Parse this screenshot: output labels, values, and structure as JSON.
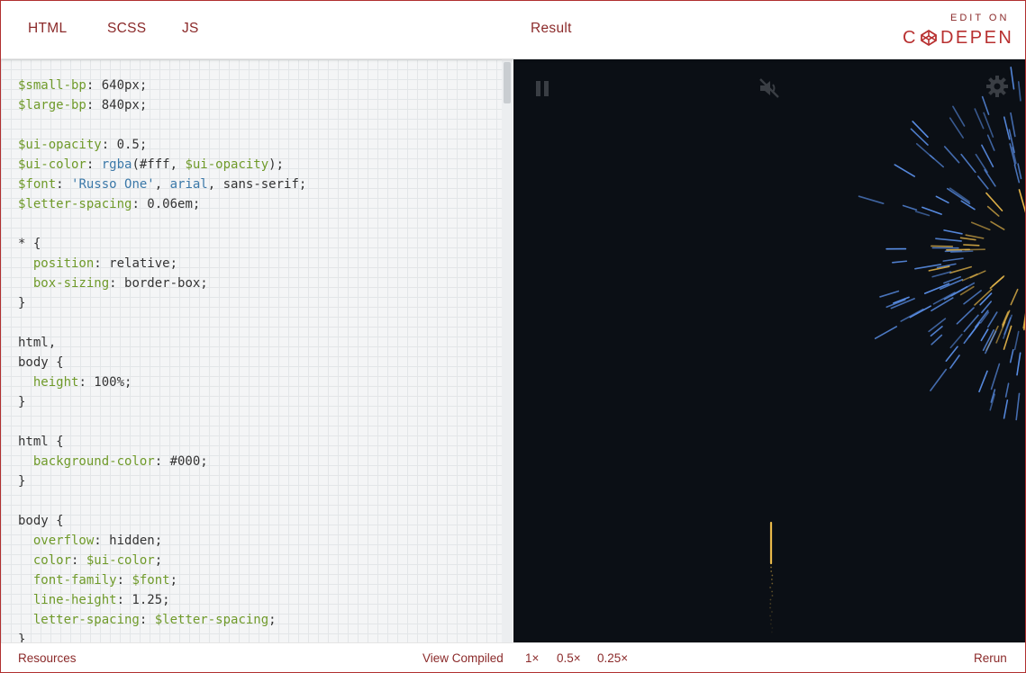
{
  "header": {
    "tabs": [
      "HTML",
      "SCSS",
      "JS"
    ],
    "result_label": "Result",
    "edit_on": "EDIT ON",
    "brand": "CODEPEN",
    "brand_prefix": "C",
    "brand_suffix": "DEPEN"
  },
  "code_lines": [
    [
      [
        "v",
        "$small-bp"
      ],
      [
        "t",
        ": 640px;"
      ]
    ],
    [
      [
        "v",
        "$large-bp"
      ],
      [
        "t",
        ": 840px;"
      ]
    ],
    [],
    [
      [
        "v",
        "$ui-opacity"
      ],
      [
        "t",
        ": 0.5;"
      ]
    ],
    [
      [
        "v",
        "$ui-color"
      ],
      [
        "t",
        ": "
      ],
      [
        "s",
        "rgba"
      ],
      [
        "t",
        "(#fff, "
      ],
      [
        "v",
        "$ui-opacity"
      ],
      [
        "t",
        ");"
      ]
    ],
    [
      [
        "v",
        "$font"
      ],
      [
        "t",
        ": "
      ],
      [
        "s",
        "'Russo One'"
      ],
      [
        "t",
        ", "
      ],
      [
        "s",
        "arial"
      ],
      [
        "t",
        ", sans-serif;"
      ]
    ],
    [
      [
        "v",
        "$letter-spacing"
      ],
      [
        "t",
        ": 0.06em;"
      ]
    ],
    [],
    [
      [
        "t",
        "* {"
      ]
    ],
    [
      [
        "t",
        "  "
      ],
      [
        "p",
        "position"
      ],
      [
        "t",
        ": relative;"
      ]
    ],
    [
      [
        "t",
        "  "
      ],
      [
        "p",
        "box-sizing"
      ],
      [
        "t",
        ": border-box;"
      ]
    ],
    [
      [
        "t",
        "}"
      ]
    ],
    [],
    [
      [
        "t",
        "html,"
      ]
    ],
    [
      [
        "t",
        "body {"
      ]
    ],
    [
      [
        "t",
        "  "
      ],
      [
        "p",
        "height"
      ],
      [
        "t",
        ": 100%;"
      ]
    ],
    [
      [
        "t",
        "}"
      ]
    ],
    [],
    [
      [
        "t",
        "html {"
      ]
    ],
    [
      [
        "t",
        "  "
      ],
      [
        "p",
        "background-color"
      ],
      [
        "t",
        ": #000;"
      ]
    ],
    [
      [
        "t",
        "}"
      ]
    ],
    [],
    [
      [
        "t",
        "body {"
      ]
    ],
    [
      [
        "t",
        "  "
      ],
      [
        "p",
        "overflow"
      ],
      [
        "t",
        ": hidden;"
      ]
    ],
    [
      [
        "t",
        "  "
      ],
      [
        "p",
        "color"
      ],
      [
        "t",
        ": "
      ],
      [
        "v",
        "$ui-color"
      ],
      [
        "t",
        ";"
      ]
    ],
    [
      [
        "t",
        "  "
      ],
      [
        "p",
        "font-family"
      ],
      [
        "t",
        ": "
      ],
      [
        "v",
        "$font"
      ],
      [
        "t",
        ";"
      ]
    ],
    [
      [
        "t",
        "  "
      ],
      [
        "p",
        "line-height"
      ],
      [
        "t",
        ": 1.25;"
      ]
    ],
    [
      [
        "t",
        "  "
      ],
      [
        "p",
        "letter-spacing"
      ],
      [
        "t",
        ": "
      ],
      [
        "v",
        "$letter-spacing"
      ],
      [
        "t",
        ";"
      ]
    ],
    [
      [
        "t",
        "}"
      ]
    ]
  ],
  "result": {
    "controls": [
      "pause-icon",
      "mute-icon",
      "gear-icon"
    ],
    "colors": {
      "background": "#0b0f15",
      "burst_blue": "#5a8fe8",
      "burst_gold": "#e8b84a",
      "ui": "#3a3e44"
    }
  },
  "footer": {
    "resources": "Resources",
    "view_compiled": "View Compiled",
    "zoom_options": [
      "1×",
      "0.5×",
      "0.25×"
    ],
    "rerun": "Rerun"
  }
}
